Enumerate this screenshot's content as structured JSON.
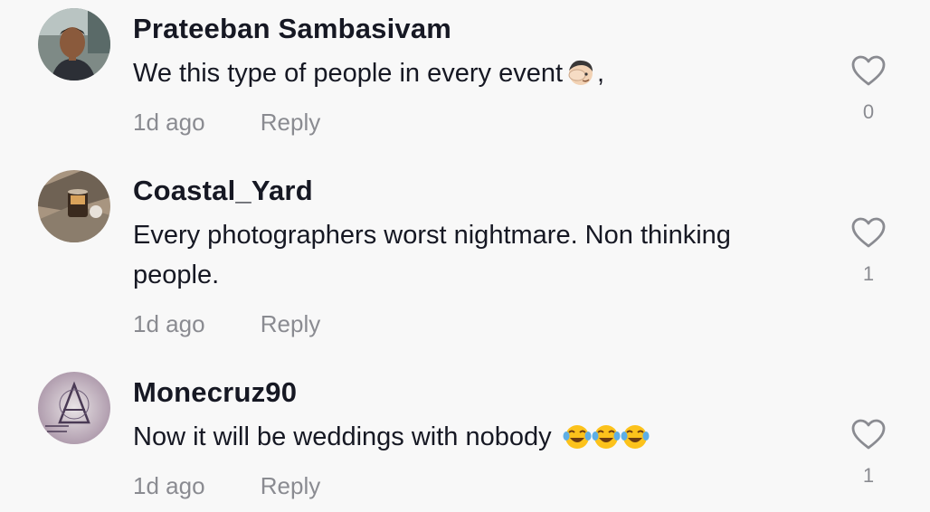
{
  "comments": [
    {
      "username": "Prateeban Sambasivam",
      "text": "We this type of people in every event",
      "text_suffix": ",",
      "emoji": "facepalm-emoji",
      "time": "1d ago",
      "reply_label": "Reply",
      "likes": "0"
    },
    {
      "username": "Coastal_Yard",
      "text": "Every photographers worst nightmare. Non thinking people.",
      "time": "1d ago",
      "reply_label": "Reply",
      "likes": "1"
    },
    {
      "username": "Monecruz90",
      "text": "Now it will be weddings with nobody",
      "emoji": "laughing-tears-emoji",
      "time": "1d ago",
      "reply_label": "Reply",
      "likes": "1"
    }
  ],
  "colors": {
    "username": "#161823",
    "text": "#161823",
    "meta": "#8a8b91",
    "background": "#f8f8f8"
  }
}
